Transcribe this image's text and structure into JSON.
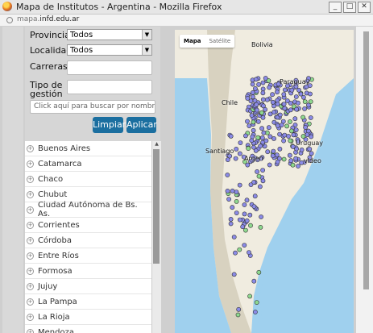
{
  "window": {
    "title": "Mapa de Institutos - Argentina - Mozilla Firefox",
    "url_prefix": "mapa.",
    "url_domain": "infd.edu.ar",
    "minimize": "_",
    "maximize": "□",
    "close": "✕"
  },
  "filters": {
    "provincia_label": "Provincia",
    "provincia_value": "Todos",
    "localidad_label": "Localidad",
    "localidad_value": "Todos",
    "carreras_label": "Carreras",
    "tipo_label_1": "Tipo de",
    "tipo_label_2": "gestión",
    "search_placeholder": "Click aquí para buscar por nombre de ins",
    "clear_button": "Limpiar",
    "apply_button": "Aplicar"
  },
  "provinces": [
    "Buenos Aires",
    "Catamarca",
    "Chaco",
    "Chubut",
    "Ciudad Autónoma de Bs. As.",
    "Corrientes",
    "Córdoba",
    "Entre Ríos",
    "Formosa",
    "Jujuy",
    "La Pampa",
    "La Rioja",
    "Mendoza"
  ],
  "map": {
    "tab_map": "Mapa",
    "tab_satellite": "Satélite",
    "labels": {
      "bolivia": "Bolivia",
      "paraguay": "Paraguay",
      "chile": "Chile",
      "santiago": "Santiago",
      "argentina": "Argen",
      "uruguay": "Uruguay",
      "montevideo": "video"
    },
    "colors": {
      "land": "#f0ece0",
      "mountains": "#d8d2c0",
      "ocean": "#9fd0ee",
      "marker": "#8a8ae6",
      "marker_highlight": "#8ed88e"
    }
  }
}
